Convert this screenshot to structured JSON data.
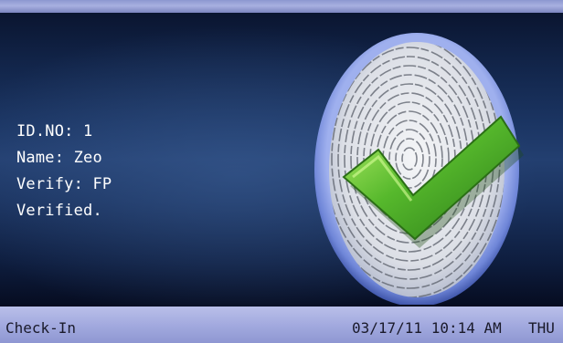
{
  "verification": {
    "id_line": "ID.NO: 1",
    "name_line": "Name: Zeo",
    "verify_line": "Verify: FP",
    "status_line": "Verified."
  },
  "status_bar": {
    "mode": "Check-In",
    "date": "03/17/11",
    "time": "10:14",
    "ampm": "AM",
    "weekday": "THU"
  },
  "icons": {
    "badge": "fingerprint-check-icon"
  },
  "colors": {
    "background_dark": "#0a1530",
    "background_mid": "#233f70",
    "status_bar": "#a3aadf",
    "check_green": "#4aa82a",
    "badge_ring": "#6f86d8"
  }
}
